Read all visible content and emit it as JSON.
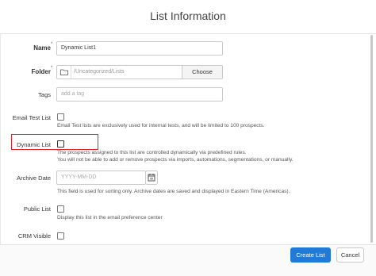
{
  "dialog": {
    "title": "List Information"
  },
  "fields": {
    "name": {
      "label": "Name",
      "required": "*",
      "value": "Dynamic List1"
    },
    "folder": {
      "label": "Folder",
      "required": "*",
      "path": "/Uncategorized/Lists",
      "button": "Choose"
    },
    "tags": {
      "label": "Tags",
      "placeholder": "add a tag"
    },
    "email_test_list": {
      "label": "Email Test List",
      "help": "Email Test lists are exclusively used for internal tests, and will be limited to 100 prospects.",
      "checked": false
    },
    "dynamic_list": {
      "label": "Dynamic List",
      "help1": "The prospects assigned to this list are controlled dynamically via predefined rules.",
      "help2": "You will not be able to add or remove prospects via imports, automations, segmentations, or manually.",
      "checked": false
    },
    "archive_date": {
      "label": "Archive Date",
      "placeholder": "YYYY-MM-DD",
      "help": "This field is used for sorting only. Archive dates are saved and displayed in Eastern Time (Americas)."
    },
    "public_list": {
      "label": "Public List",
      "help": "Display this list in the email preference center",
      "checked": false
    },
    "crm_visible": {
      "label": "CRM Visible",
      "checked": false
    }
  },
  "footer": {
    "create": "Create List",
    "cancel": "Cancel"
  },
  "colors": {
    "primary": "#1f7ad8",
    "highlight": "#e0252b",
    "required": "#c23934"
  },
  "icons": [
    "folder-icon",
    "calendar-icon"
  ]
}
